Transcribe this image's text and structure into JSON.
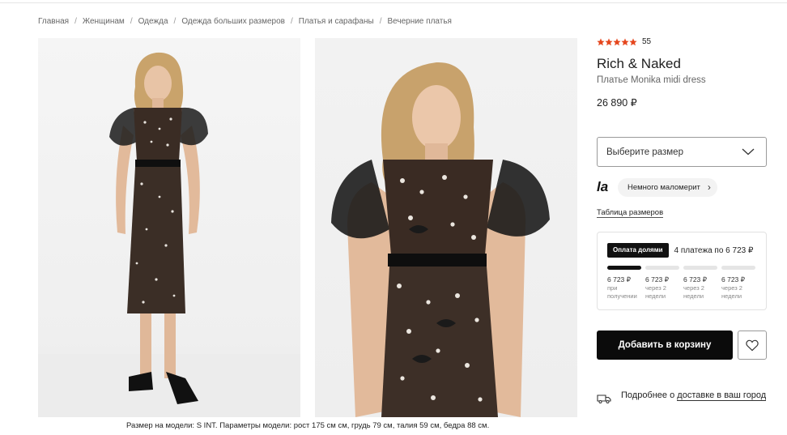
{
  "breadcrumbs": [
    "Главная",
    "Женщинам",
    "Одежда",
    "Одежда больших размеров",
    "Платья и сарафаны",
    "Вечерние платья"
  ],
  "breadcrumb_separator": "/",
  "product": {
    "rating_count": "55",
    "rating_stars": 5,
    "star_color": "#e5461d",
    "brand": "Rich & Naked",
    "name": "Платье Monika midi dress",
    "price": "26 890 ₽"
  },
  "size_select": {
    "placeholder": "Выберите размер",
    "icon": "chevron-down-icon"
  },
  "fit": {
    "logo_text": "la",
    "badge_text": "Немного маломерит"
  },
  "size_table_link": "Таблица размеров",
  "installments": {
    "badge": "Оплата долями",
    "summary": "4 платежа по 6 723 ₽",
    "payments": [
      {
        "amount": "6 723 ₽",
        "when_line1": "при",
        "when_line2": "получении",
        "active": true
      },
      {
        "amount": "6 723 ₽",
        "when_line1": "через 2",
        "when_line2": "недели",
        "active": false
      },
      {
        "amount": "6 723 ₽",
        "when_line1": "через 2",
        "when_line2": "недели",
        "active": false
      },
      {
        "amount": "6 723 ₽",
        "when_line1": "через 2",
        "when_line2": "недели",
        "active": false
      }
    ]
  },
  "add_to_cart": "Добавить в корзину",
  "favorite_icon": "heart-icon",
  "delivery": {
    "prefix": "Подробнее о ",
    "link": "доставке в ваш город",
    "icon": "truck-icon"
  },
  "model_note": "Размер на модели: S INT. Параметры модели: рост 175 см см, грудь 79 см, талия 59 см, бедра 88 см."
}
